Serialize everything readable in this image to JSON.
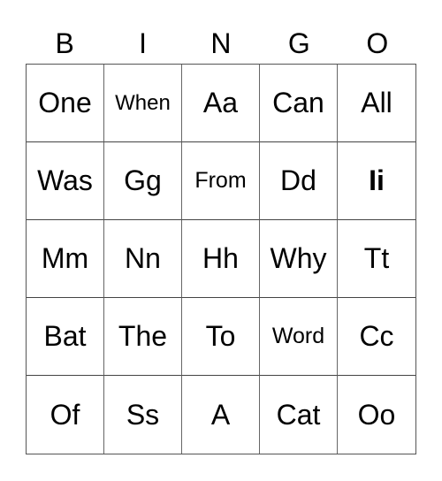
{
  "header": {
    "letters": [
      "B",
      "I",
      "N",
      "G",
      "O"
    ]
  },
  "grid": {
    "rows": [
      [
        "One",
        "When",
        "Aa",
        "Can",
        "All"
      ],
      [
        "Was",
        "Gg",
        "From",
        "Dd",
        "Ii"
      ],
      [
        "Mm",
        "Nn",
        "Hh",
        "Why",
        "Tt"
      ],
      [
        "Bat",
        "The",
        "To",
        "Word",
        "Cc"
      ],
      [
        "Of",
        "Ss",
        "A",
        "Cat",
        "Oo"
      ]
    ]
  }
}
